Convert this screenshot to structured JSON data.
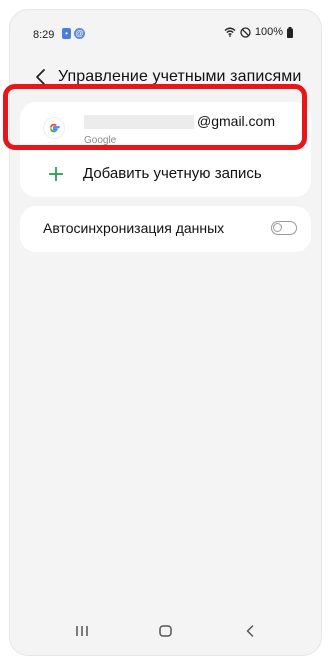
{
  "status_bar": {
    "time": "8:29",
    "battery": "100%",
    "notification_icons": [
      "apps-notification-icon",
      "alarm-notification-icon"
    ]
  },
  "header": {
    "title": "Управление учетными записями"
  },
  "account": {
    "email_suffix": "@gmail.com",
    "type": "Google"
  },
  "add_account": {
    "label": "Добавить учетную запись"
  },
  "sync": {
    "label": "Автосинхронизация данных",
    "enabled": false
  },
  "colors": {
    "background": "#f4f4f4",
    "card": "#ffffff",
    "highlight": "#e8151b",
    "plus": "#2e9e52"
  }
}
